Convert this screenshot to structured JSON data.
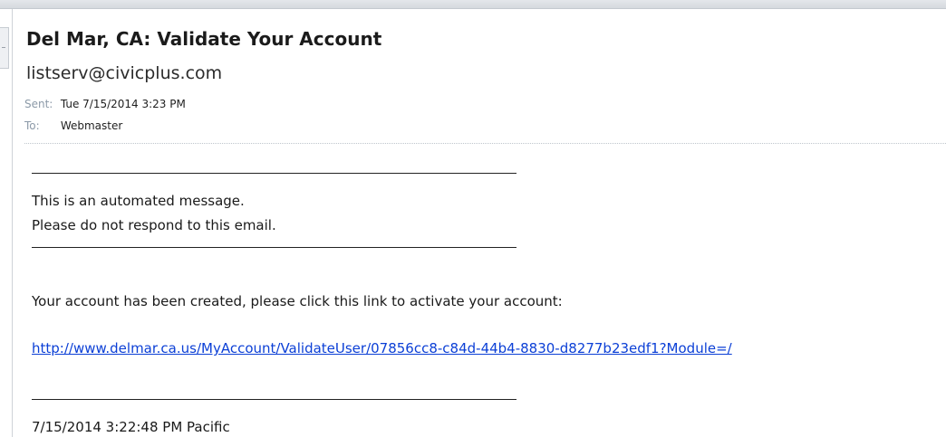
{
  "email": {
    "subject": "Del Mar, CA: Validate Your Account",
    "from": "listserv@civicplus.com",
    "sent_label": "Sent:",
    "sent_value": "Tue 7/15/2014 3:23 PM",
    "to_label": "To:",
    "to_value": "Webmaster"
  },
  "body": {
    "line1": "This is an automated message.",
    "line2": "Please do not respond to this email.",
    "line3": "Your account has been created, please click this link to activate your account:",
    "link": "http://www.delmar.ca.us/MyAccount/ValidateUser/07856cc8-c84d-44b4-8830-d8277b23edf1?Module=/",
    "timestamp": "7/15/2014 3:22:48 PM Pacific"
  },
  "colors": {
    "link": "#0b3fd6",
    "meta_label": "#8c9aa8"
  }
}
